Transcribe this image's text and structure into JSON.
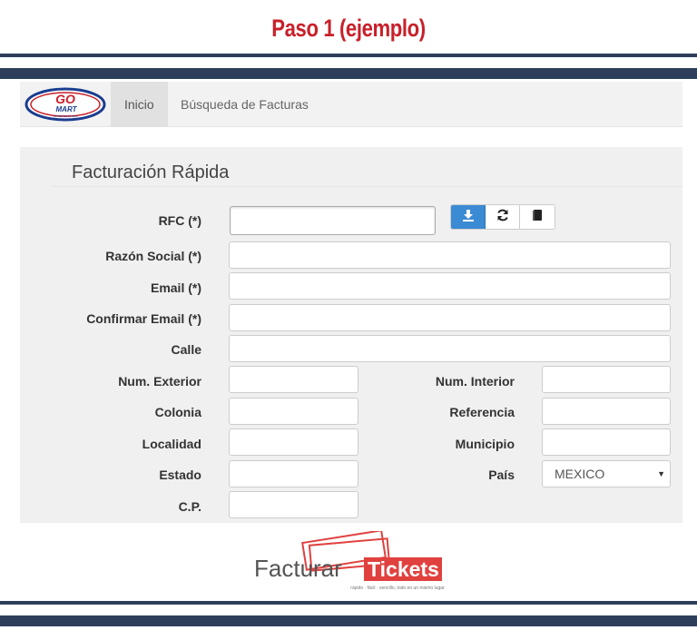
{
  "header": {
    "step_title": "Paso 1 (ejemplo)"
  },
  "navbar": {
    "logo_text_1": "GO",
    "logo_text_2": "MART",
    "logo_tagline": "SUPER DE 24 HRS",
    "items": [
      {
        "label": "Inicio",
        "active": true
      },
      {
        "label": "Búsqueda de Facturas",
        "active": false
      }
    ]
  },
  "form": {
    "title": "Facturación Rápida",
    "fields": {
      "rfc": {
        "label": "RFC (*)",
        "value": ""
      },
      "razon_social": {
        "label": "Razón Social (*)",
        "value": ""
      },
      "email": {
        "label": "Email (*)",
        "value": ""
      },
      "confirmar_email": {
        "label": "Confirmar Email (*)",
        "value": ""
      },
      "calle": {
        "label": "Calle",
        "value": ""
      },
      "num_exterior": {
        "label": "Num. Exterior",
        "value": ""
      },
      "num_interior": {
        "label": "Num. Interior",
        "value": ""
      },
      "colonia": {
        "label": "Colonia",
        "value": ""
      },
      "referencia": {
        "label": "Referencia",
        "value": ""
      },
      "localidad": {
        "label": "Localidad",
        "value": ""
      },
      "municipio": {
        "label": "Municipio",
        "value": ""
      },
      "estado": {
        "label": "Estado",
        "value": ""
      },
      "pais": {
        "label": "País",
        "selected": "MEXICO"
      },
      "cp": {
        "label": "C.P.",
        "value": ""
      }
    },
    "rfc_buttons": [
      "download-icon",
      "refresh-icon",
      "book-icon"
    ]
  },
  "footer": {
    "brand_part1": "Facturar",
    "brand_part2": "Tickets",
    "brand_tagline": "rápido · fácil · sencillo, todo en un mismo lugar"
  },
  "colors": {
    "title_red": "#c8202a",
    "band_navy": "#2d3e5a",
    "primary_blue": "#3b8ad4",
    "brand_red": "#e0413f"
  }
}
